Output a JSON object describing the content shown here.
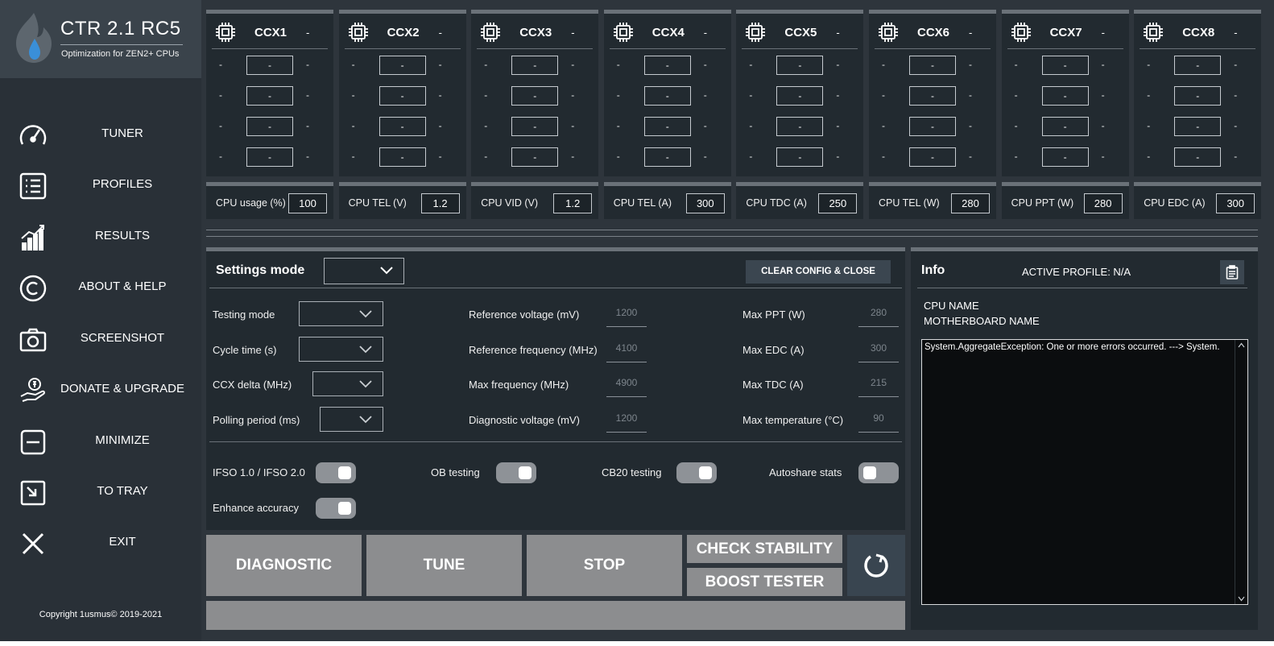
{
  "app": {
    "title": "CTR 2.1 RC5",
    "subtitle": "Optimization for ZEN2+ CPUs",
    "copyright": "Copyright 1usmus© 2019-2021"
  },
  "sidebar": {
    "items": [
      {
        "label": "TUNER",
        "icon": "gauge-icon"
      },
      {
        "label": "PROFILES",
        "icon": "list-icon"
      },
      {
        "label": "RESULTS",
        "icon": "bar-chart-icon"
      },
      {
        "label": "ABOUT & HELP",
        "icon": "copyright-icon"
      },
      {
        "label": "SCREENSHOT",
        "icon": "camera-icon"
      },
      {
        "label": "DONATE & UPGRADE",
        "icon": "donate-hand-icon"
      },
      {
        "label": "MINIMIZE",
        "icon": "minimize-icon"
      },
      {
        "label": "TO TRAY",
        "icon": "to-tray-icon"
      },
      {
        "label": "EXIT",
        "icon": "close-icon"
      }
    ]
  },
  "ccx": [
    {
      "name": "CCX1",
      "status": "-",
      "cores": [
        [
          "-",
          "-",
          "-"
        ],
        [
          "-",
          "-",
          "-"
        ],
        [
          "-",
          "-",
          "-"
        ],
        [
          "-",
          "-",
          "-"
        ]
      ]
    },
    {
      "name": "CCX2",
      "status": "-",
      "cores": [
        [
          "-",
          "-",
          "-"
        ],
        [
          "-",
          "-",
          "-"
        ],
        [
          "-",
          "-",
          "-"
        ],
        [
          "-",
          "-",
          "-"
        ]
      ]
    },
    {
      "name": "CCX3",
      "status": "-",
      "cores": [
        [
          "-",
          "-",
          "-"
        ],
        [
          "-",
          "-",
          "-"
        ],
        [
          "-",
          "-",
          "-"
        ],
        [
          "-",
          "-",
          "-"
        ]
      ]
    },
    {
      "name": "CCX4",
      "status": "-",
      "cores": [
        [
          "-",
          "-",
          "-"
        ],
        [
          "-",
          "-",
          "-"
        ],
        [
          "-",
          "-",
          "-"
        ],
        [
          "-",
          "-",
          "-"
        ]
      ]
    },
    {
      "name": "CCX5",
      "status": "-",
      "cores": [
        [
          "-",
          "-",
          "-"
        ],
        [
          "-",
          "-",
          "-"
        ],
        [
          "-",
          "-",
          "-"
        ],
        [
          "-",
          "-",
          "-"
        ]
      ]
    },
    {
      "name": "CCX6",
      "status": "-",
      "cores": [
        [
          "-",
          "-",
          "-"
        ],
        [
          "-",
          "-",
          "-"
        ],
        [
          "-",
          "-",
          "-"
        ],
        [
          "-",
          "-",
          "-"
        ]
      ]
    },
    {
      "name": "CCX7",
      "status": "-",
      "cores": [
        [
          "-",
          "-",
          "-"
        ],
        [
          "-",
          "-",
          "-"
        ],
        [
          "-",
          "-",
          "-"
        ],
        [
          "-",
          "-",
          "-"
        ]
      ]
    },
    {
      "name": "CCX8",
      "status": "-",
      "cores": [
        [
          "-",
          "-",
          "-"
        ],
        [
          "-",
          "-",
          "-"
        ],
        [
          "-",
          "-",
          "-"
        ],
        [
          "-",
          "-",
          "-"
        ]
      ]
    }
  ],
  "metrics": [
    {
      "label": "CPU usage (%)",
      "value": "100"
    },
    {
      "label": "CPU TEL (V)",
      "value": "1.2"
    },
    {
      "label": "CPU VID (V)",
      "value": "1.2"
    },
    {
      "label": "CPU TEL (A)",
      "value": "300"
    },
    {
      "label": "CPU TDC (A)",
      "value": "250"
    },
    {
      "label": "CPU TEL (W)",
      "value": "280"
    },
    {
      "label": "CPU PPT (W)",
      "value": "280"
    },
    {
      "label": "CPU EDC (A)",
      "value": "300"
    }
  ],
  "settings": {
    "title": "Settings mode",
    "mode_value": "",
    "clear_label": "CLEAR CONFIG & CLOSE",
    "left_fields": [
      {
        "label": "Testing mode",
        "value": ""
      },
      {
        "label": "Cycle time (s)",
        "value": ""
      },
      {
        "label": "CCX delta (MHz)",
        "value": ""
      },
      {
        "label": "Polling period (ms)",
        "value": ""
      }
    ],
    "mid_fields": [
      {
        "label": "Reference voltage (mV)",
        "value": "1200"
      },
      {
        "label": "Reference frequency (MHz)",
        "value": "4100"
      },
      {
        "label": "Max frequency (MHz)",
        "value": "4900"
      },
      {
        "label": "Diagnostic voltage (mV)",
        "value": "1200"
      }
    ],
    "right_fields": [
      {
        "label": "Max PPT (W)",
        "value": "280"
      },
      {
        "label": "Max EDC (A)",
        "value": "300"
      },
      {
        "label": "Max TDC (A)",
        "value": "215"
      },
      {
        "label": "Max temperature (°C)",
        "value": "90"
      }
    ],
    "toggles": [
      {
        "label": "IFSO 1.0 / IFSO 2.0",
        "on": true
      },
      {
        "label": "OB testing",
        "on": true
      },
      {
        "label": "CB20 testing",
        "on": true
      },
      {
        "label": "Autoshare stats",
        "on": false
      },
      {
        "label": "Enhance accuracy",
        "on": true
      }
    ]
  },
  "actions": {
    "diagnostic": "DIAGNOSTIC",
    "tune": "TUNE",
    "stop": "STOP",
    "check_stability": "CHECK STABILITY",
    "boost_tester": "BOOST TESTER",
    "refresh_icon": "refresh-icon",
    "progress": 0
  },
  "info": {
    "title": "Info",
    "active_profile": "ACTIVE PROFILE: N/A",
    "cpu_name": "CPU NAME",
    "motherboard_name": "MOTHERBOARD  NAME",
    "log": "System.AggregateException: One or more errors occurred. ---> System."
  },
  "colors": {
    "sidebar_bg": "#293037",
    "brand_bg": "#3a434b",
    "main_bg": "#2e353c",
    "panel_bg": "#222a30",
    "button_gray": "#8c8d8f",
    "accent_blue": "#394550"
  }
}
